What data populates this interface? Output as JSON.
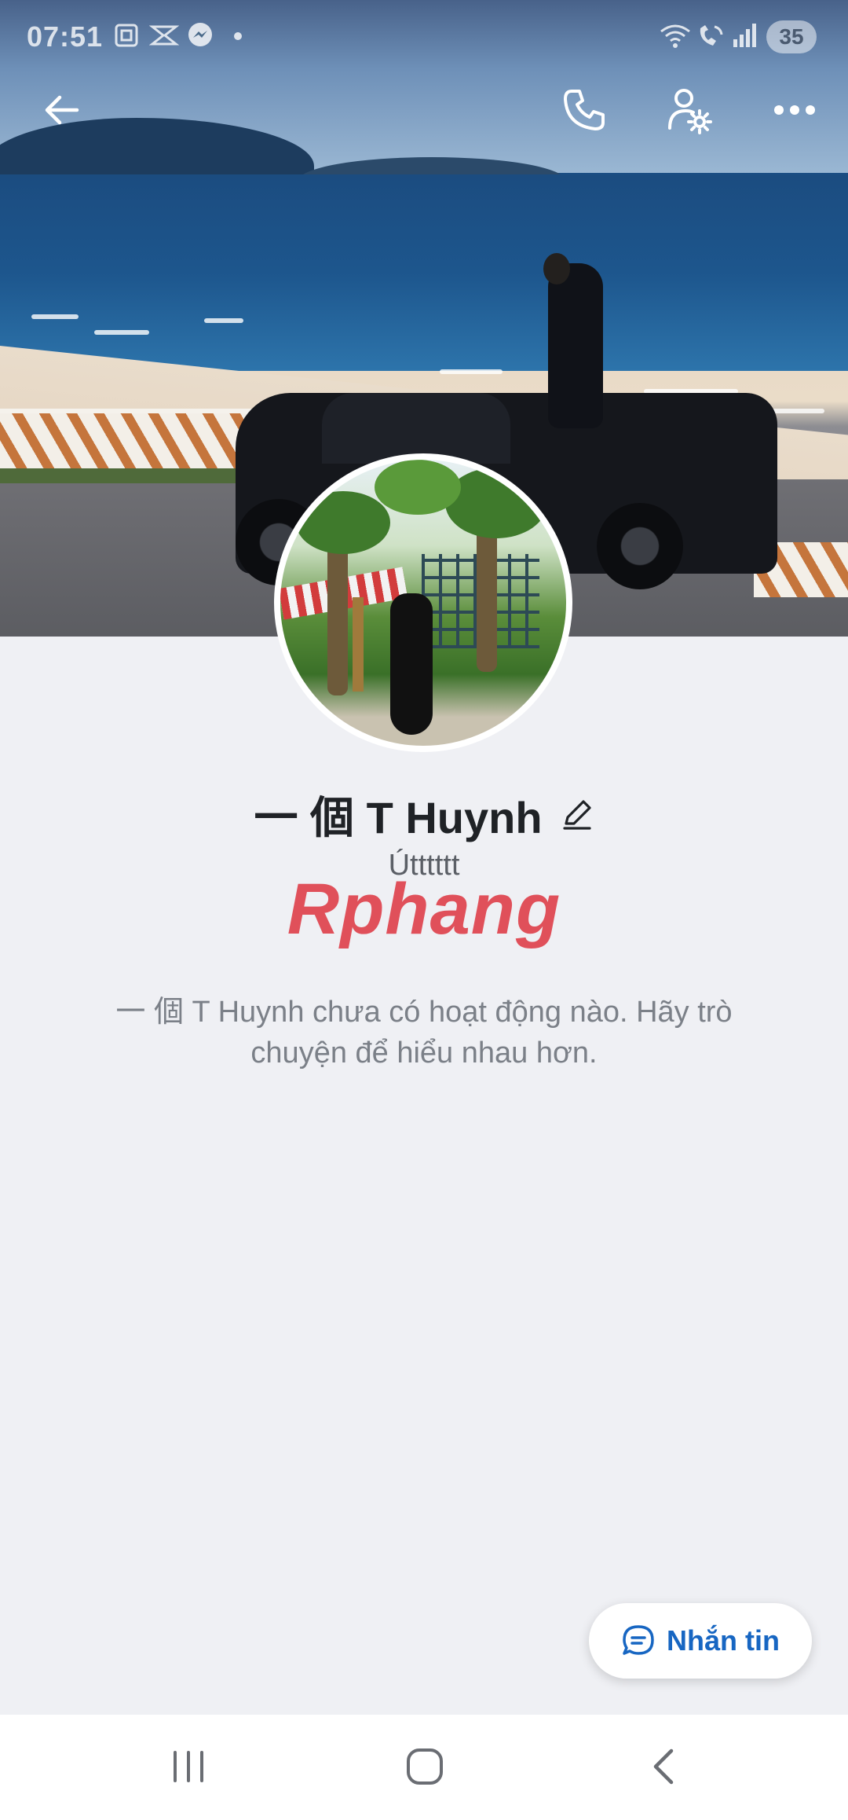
{
  "status_bar": {
    "time": "07:51",
    "battery": "35",
    "icons": [
      "screenshot-icon",
      "capcut-icon",
      "messenger-icon",
      "dot-icon",
      "wifi-icon",
      "wifi-call-icon",
      "signal-icon"
    ]
  },
  "top_bar": {
    "icons": [
      "back-arrow-icon",
      "phone-icon",
      "user-settings-icon",
      "more-icon"
    ]
  },
  "profile": {
    "name": "一 個 T Huynh",
    "subtitle": "Útttttt",
    "watermark": "Rphang",
    "empty_message": "一 個 T Huynh chưa có hoạt động nào. Hãy trò chuyện để hiểu nhau hơn."
  },
  "message_button": {
    "label": "Nhắn tin"
  },
  "colors": {
    "accent": "#1766c2",
    "background": "#eff0f4",
    "text_primary": "#1f2226",
    "text_secondary": "#7b8088"
  },
  "nav_bar": {
    "icons": [
      "recent-apps-icon",
      "home-icon",
      "back-icon"
    ]
  }
}
